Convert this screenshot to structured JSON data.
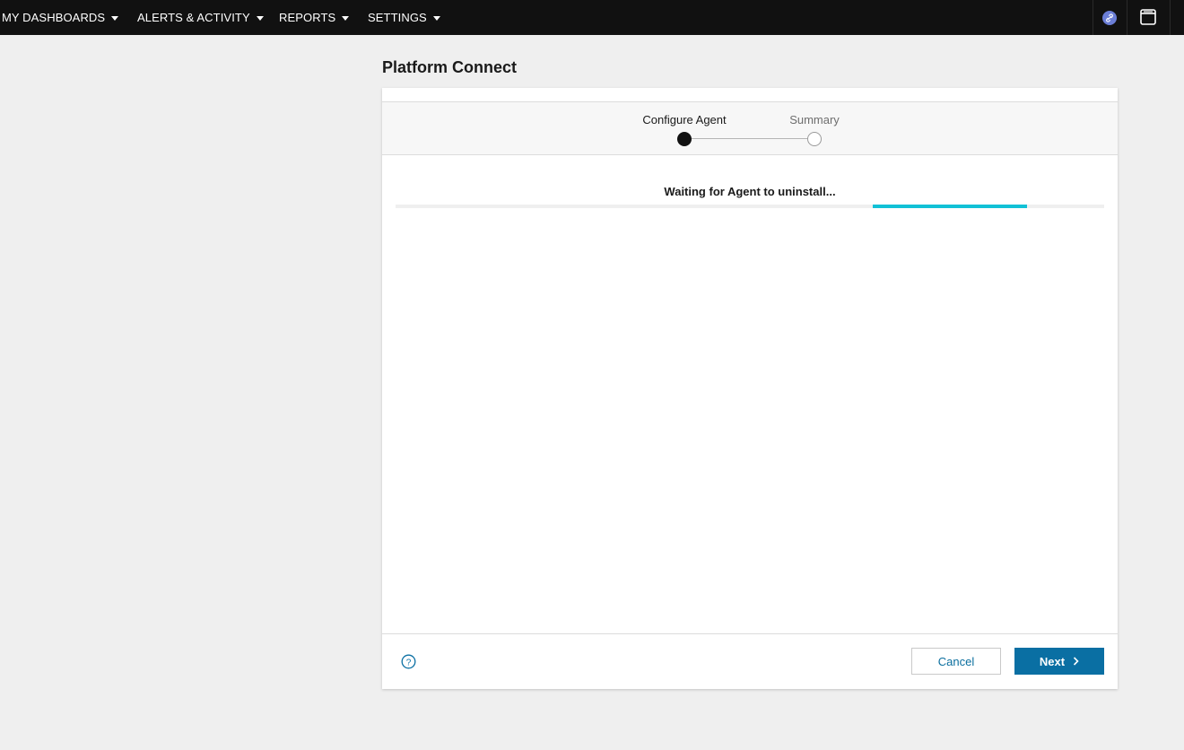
{
  "nav": {
    "items": [
      {
        "label": "MY DASHBOARDS"
      },
      {
        "label": "ALERTS & ACTIVITY"
      },
      {
        "label": "REPORTS"
      },
      {
        "label": "SETTINGS"
      }
    ],
    "right_icons": [
      "link-icon",
      "panel-icon"
    ]
  },
  "page": {
    "title": "Platform Connect"
  },
  "wizard": {
    "steps": [
      {
        "label": "Configure Agent",
        "state": "active"
      },
      {
        "label": "Summary",
        "state": "inactive"
      }
    ],
    "status_text": "Waiting for Agent to uninstall...",
    "progress": {
      "segment_start": 0.673,
      "segment_end": 0.891,
      "color": "#11c1d6"
    }
  },
  "footer": {
    "help_icon": "question-circle-icon",
    "cancel_label": "Cancel",
    "next_label": "Next"
  },
  "colors": {
    "nav_bg": "#111111",
    "primary": "#0a6fa3",
    "accent": "#11c1d6",
    "page_bg": "#efefef"
  }
}
